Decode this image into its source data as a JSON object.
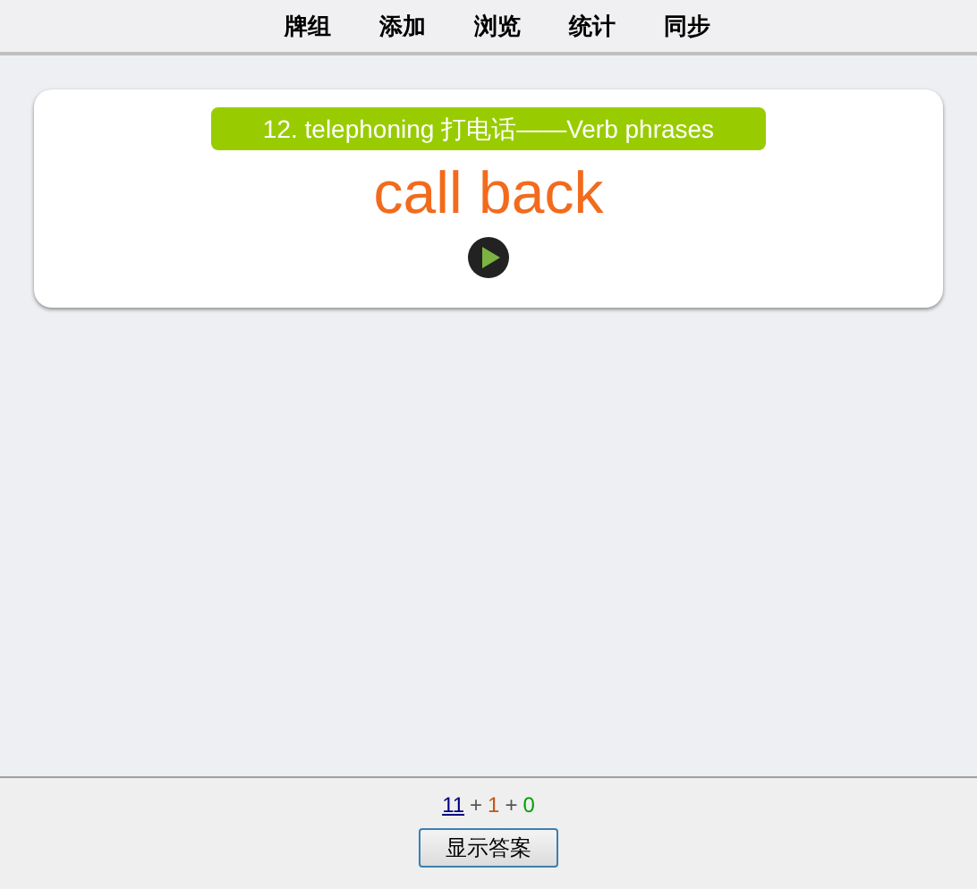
{
  "nav": {
    "items": [
      "牌组",
      "添加",
      "浏览",
      "统计",
      "同步"
    ]
  },
  "card": {
    "deck_title": "12. telephoning 打电话——Verb phrases",
    "question": "call back"
  },
  "footer": {
    "counts": [
      {
        "kind": "link",
        "text": "11",
        "color": "#000080"
      },
      {
        "kind": "separator",
        "text": "+"
      },
      {
        "kind": "count",
        "text": "1",
        "color": "#c35617"
      },
      {
        "kind": "separator",
        "text": "+"
      },
      {
        "kind": "count",
        "text": "0",
        "color": "#00a000"
      }
    ],
    "button": "显示答案"
  }
}
